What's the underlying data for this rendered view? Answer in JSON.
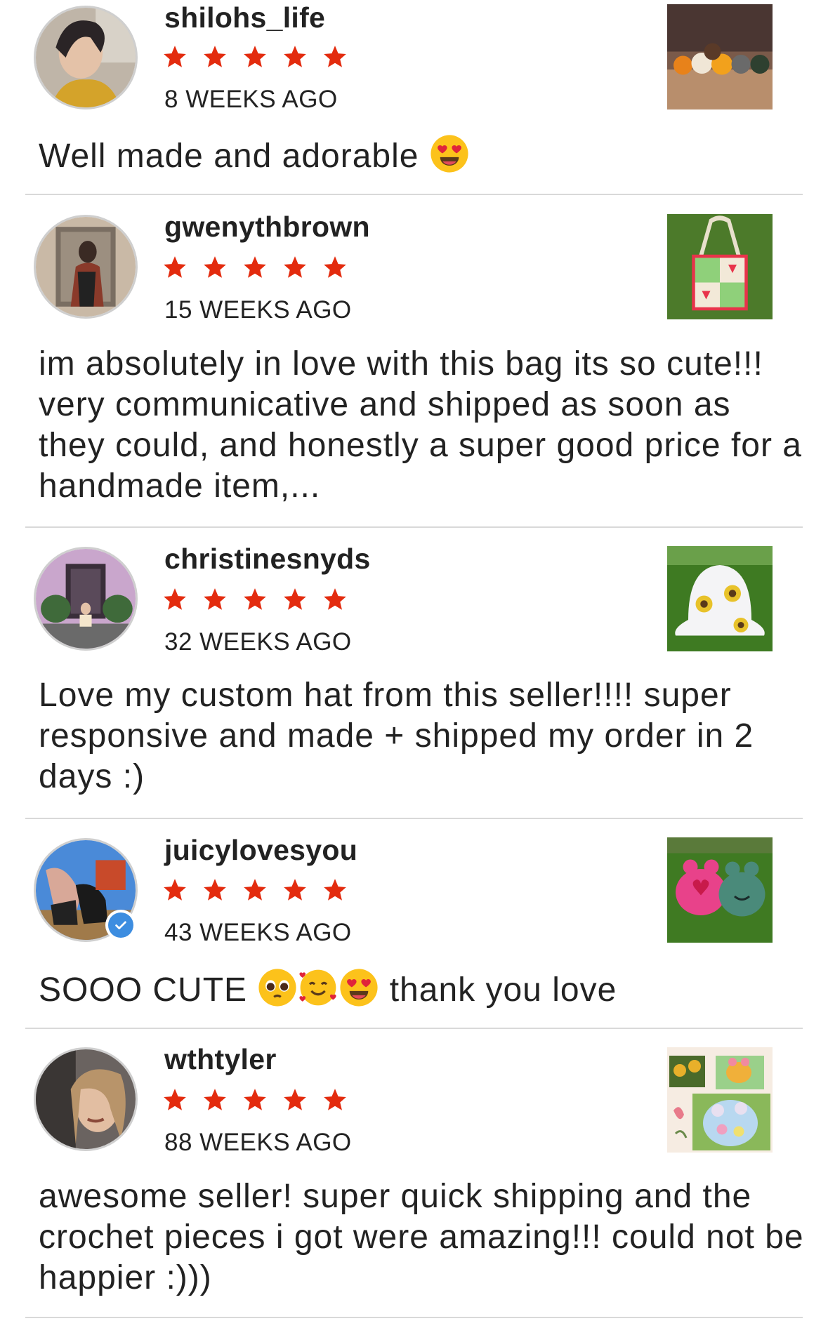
{
  "reviews": [
    {
      "username": "shilohs_life",
      "date": "8 WEEKS AGO",
      "rating": 5,
      "text": "Well made and adorable",
      "emojis": [
        "heart-eyes"
      ]
    },
    {
      "username": "gwenythbrown",
      "date": "15 WEEKS AGO",
      "rating": 5,
      "text": "im absolutely in love with this bag its so cute!!! very communicative and shipped as soon as they could, and honestly a super good price for a handmade item,..."
    },
    {
      "username": "christinesnyds",
      "date": "32 WEEKS AGO",
      "rating": 5,
      "text": "Love my custom hat from this seller!!!! super responsive and made + shipped my order in 2 days :)"
    },
    {
      "username": "juicylovesyou",
      "date": "43 WEEKS AGO",
      "rating": 5,
      "text_before": "SOOO CUTE",
      "text_after": "thank you love",
      "emojis": [
        "pleading-face",
        "smiling-face-with-hearts",
        "heart-eyes"
      ],
      "verified": true
    },
    {
      "username": "wthtyler",
      "date": "88 WEEKS AGO",
      "rating": 5,
      "text": "awesome seller! super quick shipping and the crochet pieces i got were amazing!!! could not be happier :)))"
    }
  ],
  "colors": {
    "star": "#e32b0e",
    "verified": "#3d8de0",
    "divider": "#d9d9d9"
  }
}
